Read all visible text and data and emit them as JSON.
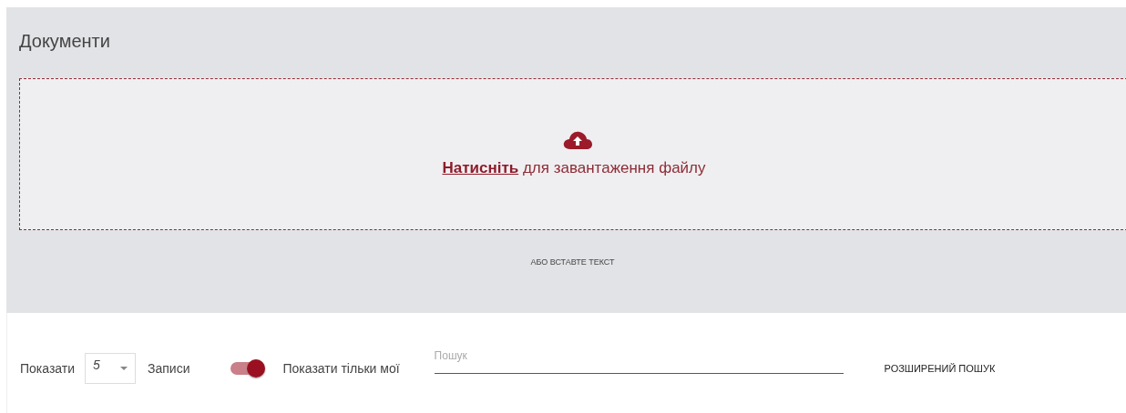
{
  "panel": {
    "title": "Документи",
    "dropzone": {
      "link": "Натисніть",
      "text": "для завантаження файлу"
    },
    "paste_link": "АБО ВСТАВТЕ ТЕКСТ"
  },
  "toolbar": {
    "show_label": "Показати",
    "page_size": "5",
    "records_label": "Записи",
    "toggle": {
      "on": true,
      "label": "Показати тільки мої"
    },
    "search": {
      "placeholder": "Пошук"
    },
    "advanced_search": "РОЗШИРЕНИЙ ПОШУК"
  }
}
